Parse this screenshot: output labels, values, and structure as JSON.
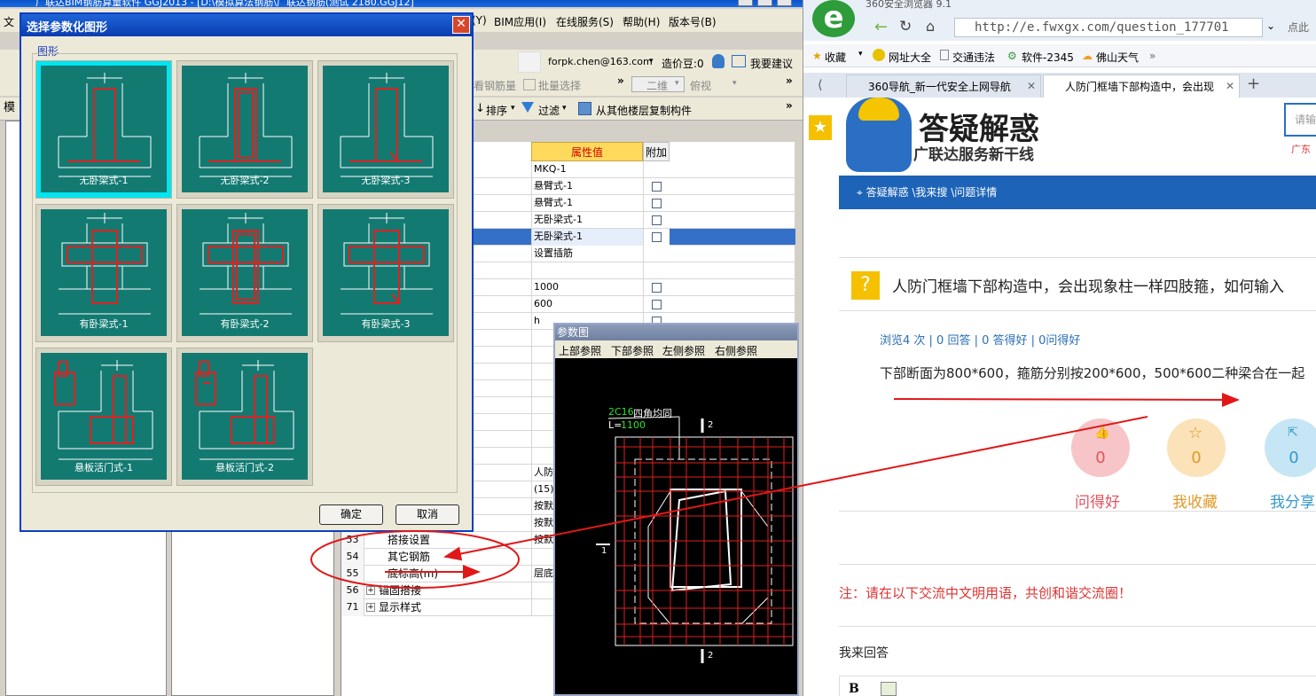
{
  "app": {
    "title": "广联达BIM钢筋算量软件 GGJ2013 - [D:\\模拟算法钢筋\\广联达钢筋(测试 2180.GGJ12]",
    "menu": [
      "文",
      "BIM应用(I)",
      "在线服务(S)",
      "帮助(H)",
      "版本号(B)"
    ],
    "menu_partial": "(Y)",
    "account": "forpk.chen@163.com",
    "cost_beans": "造价豆:0",
    "feedback": "我要建议",
    "toolbar": {
      "view_rebar": "看钢筋量",
      "batch_select": "批量选择",
      "dim_select": "二维",
      "view_mode": "俯视",
      "sort": "排序",
      "filter": "过滤",
      "copy_floor": "从其他楼层复制构件",
      "model_tab": "模"
    },
    "props": {
      "header_value": "属性值",
      "header_add": "附加",
      "rows": [
        {
          "num": "",
          "name": "",
          "value": "MKQ-1",
          "check": false
        },
        {
          "num": "",
          "name": "",
          "value": "悬臂式-1",
          "check": true
        },
        {
          "num": "",
          "name": "",
          "value": "悬臂式-1",
          "check": true
        },
        {
          "num": "",
          "name": "",
          "value": "无卧梁式-1",
          "check": true
        },
        {
          "num": "",
          "name": "",
          "value": "无卧梁式-1",
          "check": true
        },
        {
          "num": "",
          "name": "",
          "value": "设置插筋",
          "check": false
        },
        {
          "num": "",
          "name": "",
          "value": "",
          "check": false
        },
        {
          "num": "",
          "name": "",
          "value": "1000",
          "check": true
        },
        {
          "num": "",
          "name": "",
          "value": "600",
          "check": true
        },
        {
          "num": "",
          "name": "",
          "value": "h",
          "check": true
        }
      ],
      "lower_rows": [
        {
          "num": "",
          "name": "",
          "value": "人防"
        },
        {
          "num": "",
          "name": "",
          "value": "(15)"
        },
        {
          "num": "",
          "name": "",
          "value": "按默"
        },
        {
          "num": "",
          "name": "",
          "value": "按默"
        },
        {
          "num": "53",
          "name": "搭接设置",
          "value": "按默"
        },
        {
          "num": "54",
          "name": "其它钢筋",
          "value": ""
        },
        {
          "num": "55",
          "name": "底标高(m)",
          "value": "层底"
        },
        {
          "num": "56",
          "name": "锚固搭接",
          "value": ""
        },
        {
          "num": "71",
          "name": "显示样式",
          "value": ""
        }
      ]
    }
  },
  "dialog": {
    "title": "选择参数化图形",
    "group_label": "图形",
    "shapes": [
      "无卧梁式-1",
      "无卧梁式-2",
      "无卧梁式-3",
      "有卧梁式-1",
      "有卧梁式-2",
      "有卧梁式-3",
      "悬板活门式-1",
      "悬板活门式-2"
    ],
    "ok": "确定",
    "cancel": "取消"
  },
  "param_window": {
    "title": "参数图",
    "tabs": [
      "上部参照",
      "下部参照",
      "左侧参照",
      "右侧参照"
    ],
    "rebar_label": "2C16",
    "rebar_note": "四角均同",
    "length_label": "L=",
    "length_value": "1100",
    "section_top": "2",
    "section_bottom": "2",
    "section_left": "1"
  },
  "browser": {
    "title": "360安全浏览器 9.1",
    "url": "http://e.fwxgx.com/question_177701",
    "right_hint": "点此",
    "bookmarks": [
      "收藏",
      "网址大全",
      "交通违法",
      "软件-2345",
      "佛山天气"
    ],
    "tabs": [
      "360导航_新一代安全上网导航",
      "人防门框墙下部构造中，会出现"
    ],
    "site_title": "答疑解惑",
    "site_sub": "广联达服务新干线",
    "search_placeholder": "请输",
    "region": "广东",
    "breadcrumb": "答疑解惑 \\我来搜 \\问题详情",
    "question_title": "人防门框墙下部构造中，会出现象柱一样四肢箍，如何输入",
    "stats": "浏览4 次 | 0 回答 | 0 答得好 | 0问得好",
    "body": "下部断面为800*600，箍筋分别按200*600，500*600二种梁合在一起",
    "actions": [
      {
        "count": "0",
        "label": "问得好",
        "color": "#f7c5c8",
        "text_color": "#e05561"
      },
      {
        "count": "0",
        "label": "我收藏",
        "color": "#fbe2b8",
        "text_color": "#e09a2a"
      },
      {
        "count": "0",
        "label": "我分享",
        "color": "#c6e6f5",
        "text_color": "#3499c9"
      }
    ],
    "notice": "注：请在以下交流中文明用语，共创和谐交流圈！",
    "reply_label": "我来回答",
    "editor_bold": "B"
  }
}
